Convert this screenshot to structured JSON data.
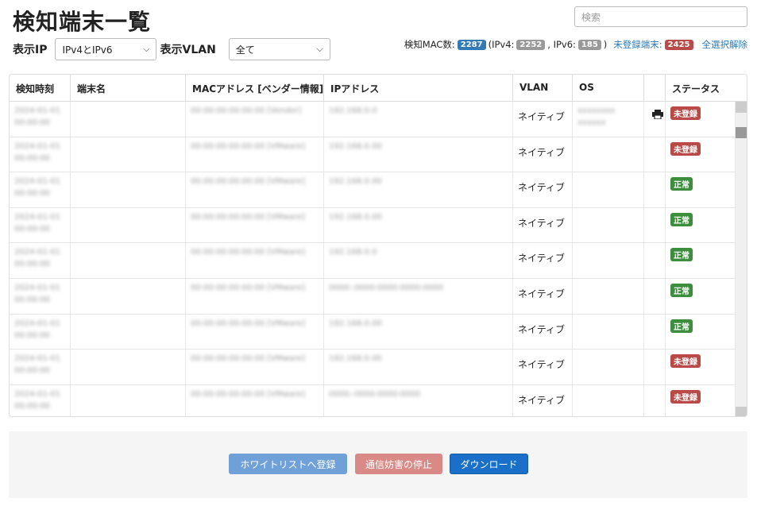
{
  "page": {
    "title": "検知端末一覧",
    "search_placeholder": "検索"
  },
  "filters": {
    "ip_label": "表示IP",
    "ip_value": "IPv4とIPv6",
    "vlan_label": "表示VLAN",
    "vlan_value": "全て"
  },
  "stats": {
    "mac_label": "検知MAC数:",
    "mac_count": "2287",
    "ipv4_prefix": "(IPv4:",
    "ipv4_count": "2252",
    "ipv6_prefix": ", IPv6:",
    "ipv6_count": "185",
    "close_paren": ")",
    "unregistered_label": "未登録端末:",
    "unregistered_count": "2425",
    "deselect_all": "全選択解除"
  },
  "table": {
    "columns": [
      "検知時刻",
      "端末名",
      "MACアドレス [ベンダー情報]↑",
      "IPアドレス",
      "VLAN",
      "OS",
      "",
      "ステータス"
    ],
    "rows": [
      {
        "time1": "2024-01-01",
        "time2": "00:00:00",
        "name": "",
        "mac": "00:00:00:00:00:00 [Vendor]",
        "ip": "192.168.0.0",
        "vlan": "ネイティブ",
        "os1": "xxxxxxxx",
        "os2": "xxxxxx",
        "status": "未登録",
        "status_color": "#b94a48",
        "has_icon": true
      },
      {
        "time1": "2024-01-01",
        "time2": "00:00:00",
        "name": "",
        "mac": "00:00:00:00:00:00 [VMware]",
        "ip": "192.168.0.00",
        "vlan": "ネイティブ",
        "os1": "",
        "os2": "",
        "status": "未登録",
        "status_color": "#b94a48",
        "has_icon": false
      },
      {
        "time1": "2024-01-01",
        "time2": "00:00:00",
        "name": "",
        "mac": "00:00:00:00:00:00 [VMware]",
        "ip": "192.168.0.00",
        "vlan": "ネイティブ",
        "os1": "",
        "os2": "",
        "status": "正常",
        "status_color": "#3c8d3c",
        "has_icon": false
      },
      {
        "time1": "2024-01-01",
        "time2": "00:00:00",
        "name": "",
        "mac": "00:00:00:00:00:00 [VMware]",
        "ip": "192.168.0.00",
        "vlan": "ネイティブ",
        "os1": "",
        "os2": "",
        "status": "正常",
        "status_color": "#3c8d3c",
        "has_icon": false
      },
      {
        "time1": "2024-01-01",
        "time2": "00:00:00",
        "name": "",
        "mac": "00:00:00:00:00:00 [VMware]",
        "ip": "192.168.0.0",
        "vlan": "ネイティブ",
        "os1": "",
        "os2": "",
        "status": "正常",
        "status_color": "#3c8d3c",
        "has_icon": false
      },
      {
        "time1": "2024-01-01",
        "time2": "00:00:00",
        "name": "",
        "mac": "00:00:00:00:00:00 [VMware]",
        "ip": "0000::0000:0000:0000:0000",
        "vlan": "ネイティブ",
        "os1": "",
        "os2": "",
        "status": "正常",
        "status_color": "#3c8d3c",
        "has_icon": false
      },
      {
        "time1": "2024-01-01",
        "time2": "00:00:00",
        "name": "",
        "mac": "00:00:00:00:00:00 [VMware]",
        "ip": "192.168.0.00",
        "vlan": "ネイティブ",
        "os1": "",
        "os2": "",
        "status": "正常",
        "status_color": "#3c8d3c",
        "has_icon": false
      },
      {
        "time1": "2024-01-01",
        "time2": "00:00:00",
        "name": "",
        "mac": "00:00:00:00:00:00 [VMware]",
        "ip": "192.168.0.00",
        "vlan": "ネイティブ",
        "os1": "",
        "os2": "",
        "status": "未登録",
        "status_color": "#b94a48",
        "has_icon": false
      },
      {
        "time1": "2024-01-01",
        "time2": "00:00:00",
        "name": "",
        "mac": "00:00:00:00:00:00 [VMware]",
        "ip": "0000::0000:0000:0000",
        "vlan": "ネイティブ",
        "os1": "",
        "os2": "",
        "status": "未登録",
        "status_color": "#b94a48",
        "has_icon": false
      }
    ]
  },
  "footer": {
    "whitelist_button": "ホワイトリストへ登録",
    "stop_button": "通信妨害の停止",
    "download_button": "ダウンロード"
  },
  "colors": {
    "badge_blue": "#337ab7",
    "badge_gray": "#999999",
    "badge_red": "#b94a48",
    "status_red": "#b94a48",
    "status_green": "#3c8d3c",
    "link": "#2a7ab8",
    "primary": "#1a6fc9"
  },
  "icons": {
    "device": "printer-icon",
    "select": "chevron-down-icon"
  }
}
